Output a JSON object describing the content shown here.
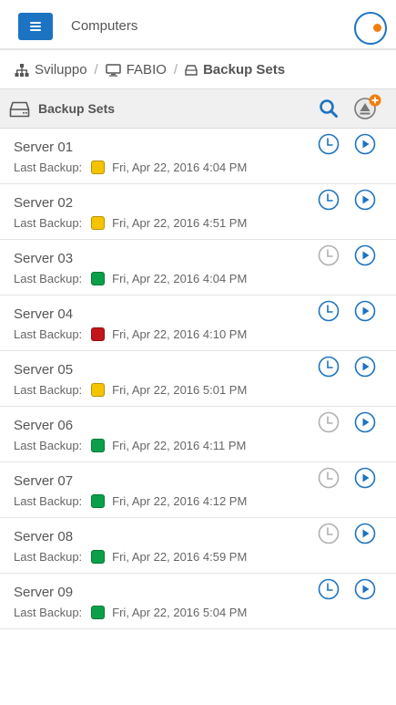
{
  "topbar": {
    "title": "Computers",
    "status_color": "#f07f0f"
  },
  "breadcrumb": [
    {
      "label": "Sviluppo",
      "icon": "sitemap-icon"
    },
    {
      "label": "FABIO",
      "icon": "monitor-icon"
    },
    {
      "label": "Backup Sets",
      "icon": "hdd-icon"
    }
  ],
  "section": {
    "title": "Backup Sets",
    "icon": "hdd-icon"
  },
  "colors": {
    "accent": "#1c73c1",
    "inactive": "#b0b0b0",
    "yellow": "#f5c400",
    "green": "#0aa04a",
    "red": "#c0161b"
  },
  "rows": [
    {
      "name": "Server 01",
      "label": "Last Backup:",
      "status": "yellow",
      "date": "Fri, Apr 22, 2016 4:04 PM",
      "scheduled": true
    },
    {
      "name": "Server 02",
      "label": "Last Backup:",
      "status": "yellow",
      "date": "Fri, Apr 22, 2016 4:51 PM",
      "scheduled": true
    },
    {
      "name": "Server 03",
      "label": "Last Backup:",
      "status": "green",
      "date": "Fri, Apr 22, 2016 4:04 PM",
      "scheduled": false
    },
    {
      "name": "Server 04",
      "label": "Last Backup:",
      "status": "red",
      "date": "Fri, Apr 22, 2016 4:10 PM",
      "scheduled": true
    },
    {
      "name": "Server 05",
      "label": "Last Backup:",
      "status": "yellow",
      "date": "Fri, Apr 22, 2016 5:01 PM",
      "scheduled": true
    },
    {
      "name": "Server 06",
      "label": "Last Backup:",
      "status": "green",
      "date": "Fri, Apr 22, 2016 4:11 PM",
      "scheduled": false
    },
    {
      "name": "Server 07",
      "label": "Last Backup:",
      "status": "green",
      "date": "Fri, Apr 22, 2016 4:12 PM",
      "scheduled": false
    },
    {
      "name": "Server 08",
      "label": "Last Backup:",
      "status": "green",
      "date": "Fri, Apr 22, 2016 4:59 PM",
      "scheduled": false
    },
    {
      "name": "Server 09",
      "label": "Last Backup:",
      "status": "green",
      "date": "Fri, Apr 22, 2016 5:04 PM",
      "scheduled": true
    }
  ]
}
